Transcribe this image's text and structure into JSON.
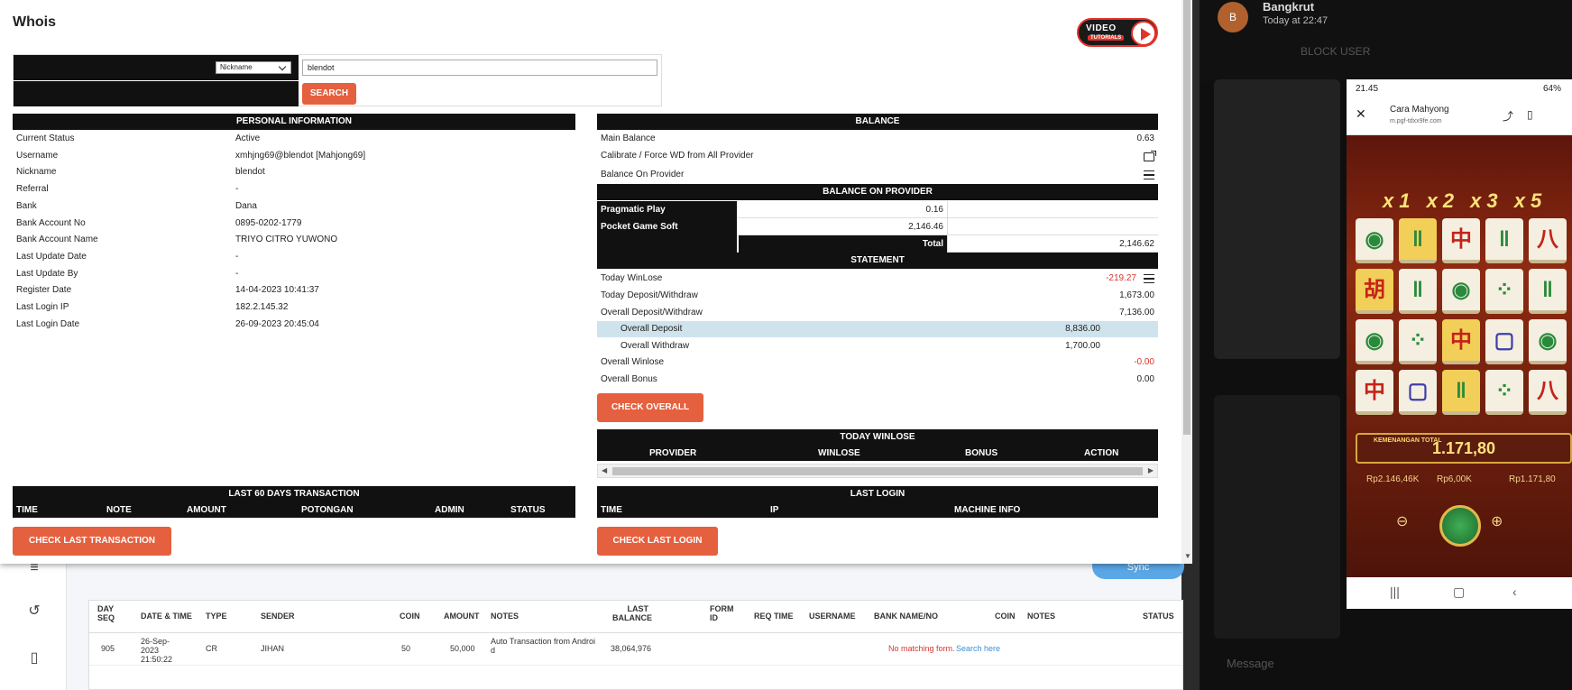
{
  "background": {
    "sync_label": "Sync",
    "table_headers": [
      "DAY SEQ",
      "DATE & TIME",
      "TYPE",
      "SENDER",
      "COIN",
      "AMOUNT",
      "NOTES",
      "LAST BALANCE",
      "FORM ID",
      "REQ TIME",
      "USERNAME",
      "BANK NAME/NO",
      "COIN",
      "NOTES",
      "STATUS"
    ],
    "row": {
      "day_seq": "905",
      "datetime": "26-Sep-2023 21:50:22",
      "type": "CR",
      "sender": "JIHAN",
      "coin": "50",
      "amount": "50,000",
      "notes": "Auto Transaction from Androi d",
      "last_balance": "38,064,976",
      "no_match": "No matching form.",
      "search_here": "Search here"
    }
  },
  "chat": {
    "avatar_letter": "B",
    "name": "Bangkrut",
    "time": "Today at 22:47",
    "block_user": "BLOCK USER",
    "message_placeholder": "Message"
  },
  "phone": {
    "status_time": "21.45",
    "battery": "64%",
    "page_title": "Cara Mahyong",
    "page_url": "m.pgf-tdxx9fe.com",
    "multipliers": "x1 x2 x3 x5",
    "win_label": "KEMENANGAN TOTAL",
    "win_value": "1.171,80",
    "stat_balance": "Rp2.146,46K",
    "stat_bet": "Rp6,00K",
    "stat_win": "Rp1.171,80"
  },
  "modal": {
    "title": "Whois",
    "video_label": "VIDEO",
    "video_sub": "TUTORIALS",
    "search": {
      "select_value": "Nickname",
      "input_value": "blendot",
      "button": "SEARCH"
    },
    "personal": {
      "header": "PERSONAL INFORMATION",
      "rows": [
        {
          "k": "Current Status",
          "v": "Active"
        },
        {
          "k": "Username",
          "v": "xmhjng69@blendot  [Mahjong69]"
        },
        {
          "k": "Nickname",
          "v": "blendot"
        },
        {
          "k": "Referral",
          "v": "-"
        },
        {
          "k": "Bank",
          "v": "Dana"
        },
        {
          "k": "Bank Account No",
          "v": "0895-0202-1779"
        },
        {
          "k": "Bank Account Name",
          "v": "TRIYO CITRO YUWONO"
        },
        {
          "k": "Last Update Date",
          "v": "-"
        },
        {
          "k": "Last Update By",
          "v": "-"
        },
        {
          "k": "Register Date",
          "v": "14-04-2023 10:41:37"
        },
        {
          "k": "Last Login IP",
          "v": "182.2.145.32"
        },
        {
          "k": "Last Login Date",
          "v": "26-09-2023 20:45:04"
        }
      ]
    },
    "balance": {
      "header": "BALANCE",
      "main_balance_label": "Main Balance",
      "main_balance_value": "0.63",
      "calibrate_label": "Calibrate / Force WD from All Provider",
      "on_provider_label": "Balance On Provider"
    },
    "provider": {
      "header": "BALANCE ON PROVIDER",
      "rows": [
        {
          "k": "Pragmatic Play",
          "v": "0.16"
        },
        {
          "k": "Pocket Game Soft",
          "v": "2,146.46"
        }
      ],
      "total_label": "Total",
      "total_value": "2,146.62"
    },
    "statement": {
      "header": "STATEMENT",
      "today_winlose_label": "Today WinLose",
      "today_winlose_value": "-219.27",
      "today_dw_label": "Today Deposit/Withdraw",
      "today_dw_value": "1,673.00",
      "overall_dw_label": "Overall Deposit/Withdraw",
      "overall_dw_value": "7,136.00",
      "overall_deposit_label": "Overall Deposit",
      "overall_deposit_value": "8,836.00",
      "overall_withdraw_label": "Overall Withdraw",
      "overall_withdraw_value": "1,700.00",
      "overall_winlose_label": "Overall Winlose",
      "overall_winlose_value": "-0.00",
      "overall_bonus_label": "Overall Bonus",
      "overall_bonus_value": "0.00",
      "check_overall": "CHECK OVERALL"
    },
    "today_winlose": {
      "header": "TODAY WINLOSE",
      "columns": [
        "PROVIDER",
        "WINLOSE",
        "BONUS",
        "ACTION"
      ]
    },
    "last60": {
      "header": "LAST 60 DAYS TRANSACTION",
      "columns": [
        "TIME",
        "NOTE",
        "AMOUNT",
        "POTONGAN",
        "ADMIN",
        "STATUS"
      ],
      "button": "CHECK LAST TRANSACTION"
    },
    "last_login": {
      "header": "LAST LOGIN",
      "columns": [
        "TIME",
        "IP",
        "MACHINE INFO"
      ],
      "button": "CHECK LAST LOGIN"
    }
  }
}
